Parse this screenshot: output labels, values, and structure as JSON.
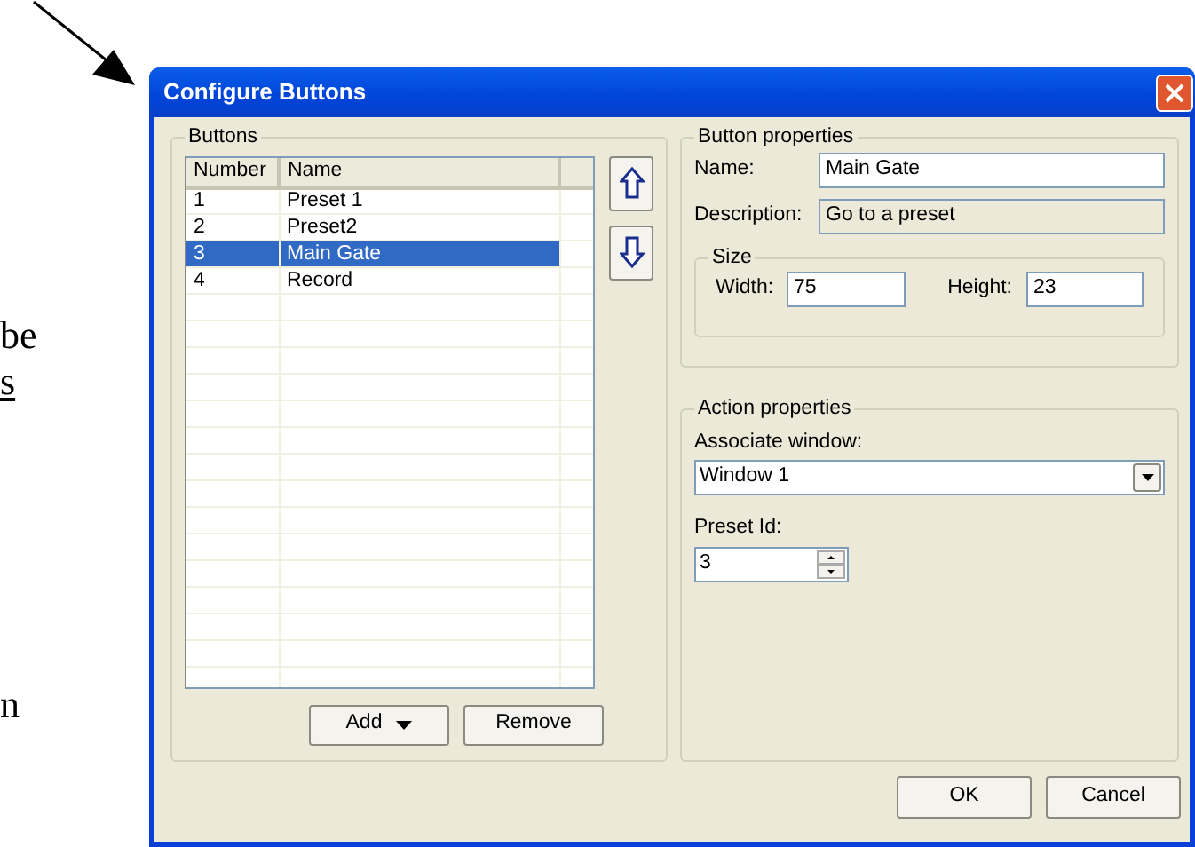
{
  "document_fragments": [
    {
      "text": "be",
      "underlined": false
    },
    {
      "text": "s",
      "underlined": true
    },
    {
      "text": "n",
      "underlined": false
    }
  ],
  "window": {
    "title": "Configure Buttons"
  },
  "buttons_group": {
    "title": "Buttons",
    "columns": [
      "Number",
      "Name"
    ],
    "rows": [
      {
        "number": "1",
        "name": "Preset 1",
        "selected": false
      },
      {
        "number": "2",
        "name": "Preset2",
        "selected": false
      },
      {
        "number": "3",
        "name": "Main Gate",
        "selected": true
      },
      {
        "number": "4",
        "name": "Record",
        "selected": false
      }
    ],
    "actions": [
      {
        "label": "Add",
        "dropdown": true
      },
      {
        "label": "Remove",
        "dropdown": false
      }
    ]
  },
  "button_properties": {
    "title": "Button properties",
    "name_label": "Name:",
    "name_value": "Main Gate",
    "description_label": "Description:",
    "description_value": "Go to a preset",
    "description_disabled": true,
    "size": {
      "title": "Size",
      "width_label": "Width:",
      "width_value": "75",
      "height_label": "Height:",
      "height_value": "23"
    }
  },
  "action_properties": {
    "title": "Action properties",
    "window_label": "Associate window:",
    "window_value": "Window 1",
    "preset_label": "Preset Id:",
    "preset_value": "3"
  },
  "dialog_buttons": [
    "OK",
    "Cancel"
  ]
}
